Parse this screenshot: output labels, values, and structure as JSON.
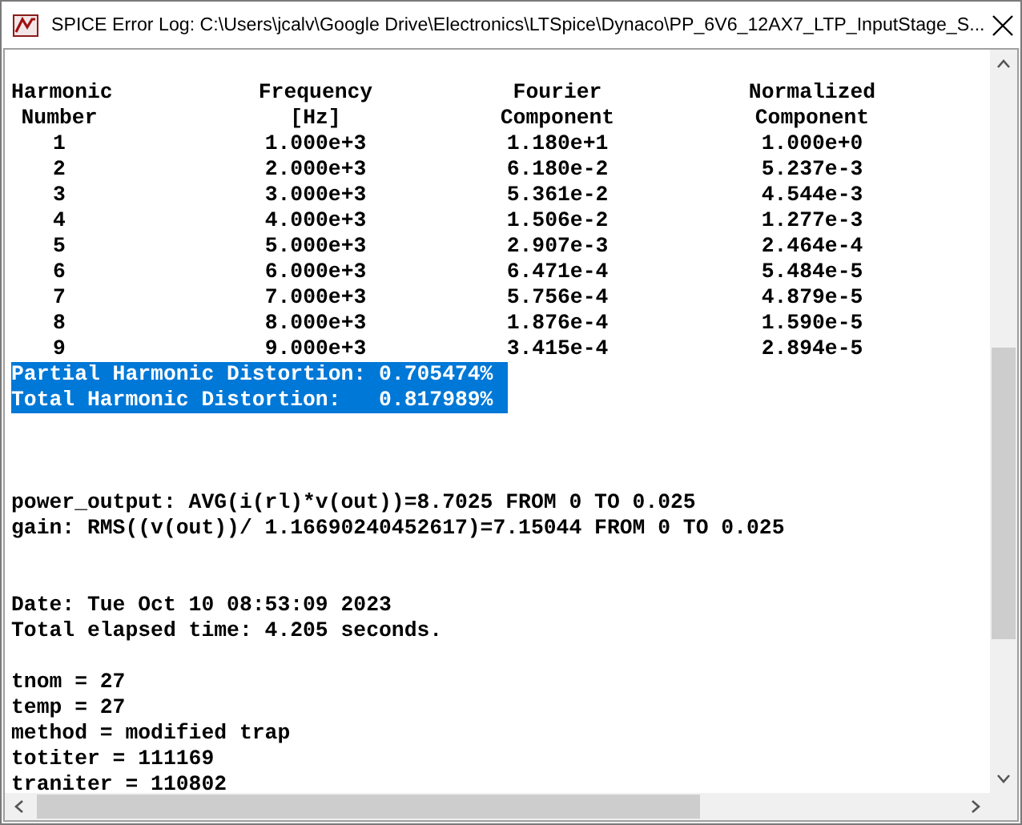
{
  "window": {
    "title": "SPICE Error Log: C:\\Users\\jcalv\\Google Drive\\Electronics\\LTSpice\\Dynaco\\PP_6V6_12AX7_LTP_InputStage_S..."
  },
  "table": {
    "columns": [
      {
        "line_1": "Harmonic",
        "line_2": "Number"
      },
      {
        "line_1": "Frequency",
        "line_2": "[Hz]"
      },
      {
        "line_1": "Fourier",
        "line_2": "Component"
      },
      {
        "line_1": "Normalized",
        "line_2": "Component"
      }
    ],
    "rows": [
      [
        "1",
        "1.000e+3",
        "1.180e+1",
        "1.000e+0"
      ],
      [
        "2",
        "2.000e+3",
        "6.180e-2",
        "5.237e-3"
      ],
      [
        "3",
        "3.000e+3",
        "5.361e-2",
        "4.544e-3"
      ],
      [
        "4",
        "4.000e+3",
        "1.506e-2",
        "1.277e-3"
      ],
      [
        "5",
        "5.000e+3",
        "2.907e-3",
        "2.464e-4"
      ],
      [
        "6",
        "6.000e+3",
        "6.471e-4",
        "5.484e-5"
      ],
      [
        "7",
        "7.000e+3",
        "5.756e-4",
        "4.879e-5"
      ],
      [
        "8",
        "8.000e+3",
        "1.876e-4",
        "1.590e-5"
      ],
      [
        "9",
        "9.000e+3",
        "3.415e-4",
        "2.894e-5"
      ]
    ]
  },
  "summary_lines": [
    {
      "text": "Partial Harmonic Distortion: 0.705474%",
      "selected": true
    },
    {
      "text": "Total Harmonic Distortion:   0.817989%",
      "selected": true
    }
  ],
  "log_sections": [
    [
      "power_output: AVG(i(rl)*v(out))=8.7025 FROM 0 TO 0.025",
      "gain: RMS((v(out))/ 1.16690240452617)=7.15044 FROM 0 TO 0.025"
    ],
    [
      "Date: Tue Oct 10 08:53:09 2023",
      "Total elapsed time: 4.205 seconds."
    ],
    [
      "tnom = 27",
      "temp = 27",
      "method = modified trap",
      "totiter = 111169",
      "traniter = 110802"
    ]
  ]
}
